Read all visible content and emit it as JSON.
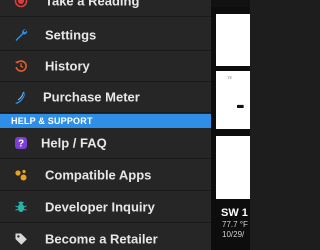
{
  "menu": {
    "items_top": [
      {
        "label": "Take a Reading",
        "icon": "record-icon",
        "color": "#e23a3a"
      },
      {
        "label": "Settings",
        "icon": "wrench-icon",
        "color": "#2f8fe6"
      },
      {
        "label": "History",
        "icon": "history-icon",
        "color": "#e85a2a"
      },
      {
        "label": "Purchase Meter",
        "icon": "meter-logo-icon",
        "color": "#2f8fe6"
      }
    ],
    "section_label": "HELP & SUPPORT",
    "items_support": [
      {
        "label": "Help / FAQ",
        "icon": "help-icon",
        "color": "#7b3fd1"
      },
      {
        "label": "Compatible Apps",
        "icon": "apps-icon",
        "color": "#e8a21c"
      },
      {
        "label": "Developer Inquiry",
        "icon": "bug-icon",
        "color": "#2bb3a8"
      },
      {
        "label": "Become a Retailer",
        "icon": "tag-icon",
        "color": "#d8d8d8"
      }
    ]
  },
  "background_panel": {
    "card_caption": "TE",
    "card_value": "-",
    "condition": "SW 1",
    "temperature": "77.7 °F",
    "date": "10/29/"
  },
  "colors": {
    "drawer_bg": "#262626",
    "section_bg": "#2f8fe6",
    "text": "#e7e7e7"
  }
}
